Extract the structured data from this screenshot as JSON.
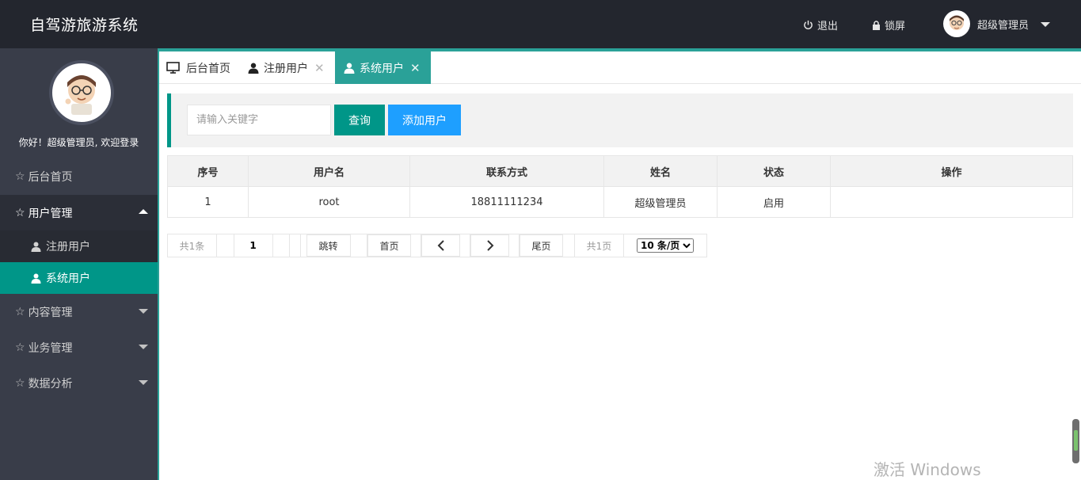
{
  "header": {
    "app_title": "自驾游旅游系统",
    "logout_label": "退出",
    "lock_label": "锁屏",
    "user_name": "超级管理员"
  },
  "sidebar": {
    "welcome": "你好！超级管理员, 欢迎登录",
    "items": [
      {
        "label": "后台首页"
      },
      {
        "label": "用户管理",
        "expanded": true,
        "children": [
          {
            "label": "注册用户"
          },
          {
            "label": "系统用户",
            "active": true
          }
        ]
      },
      {
        "label": "内容管理"
      },
      {
        "label": "业务管理"
      },
      {
        "label": "数据分析"
      }
    ]
  },
  "tabs": [
    {
      "label": "后台首页",
      "icon": "monitor-icon"
    },
    {
      "label": "注册用户",
      "icon": "user-icon",
      "closable": true
    },
    {
      "label": "系统用户",
      "icon": "user-icon",
      "closable": true,
      "active": true
    }
  ],
  "toolbar": {
    "search_placeholder": "请输入关键字",
    "query_label": "查询",
    "add_label": "添加用户"
  },
  "table": {
    "headers": [
      "序号",
      "用户名",
      "联系方式",
      "姓名",
      "状态",
      "操作"
    ],
    "rows": [
      [
        "1",
        "root",
        "18811111234",
        "超级管理员",
        "启用",
        ""
      ]
    ]
  },
  "pager": {
    "total": "共1条",
    "page_value": "1",
    "jump": "跳转",
    "first": "首页",
    "last": "尾页",
    "pages": "共1页",
    "page_size": "10 条/页"
  },
  "watermark": "激活 Windows",
  "colors": {
    "header_bg": "#23262e",
    "sidebar_bg": "#393d49",
    "accent": "#009688",
    "blue": "#1e9fff"
  }
}
